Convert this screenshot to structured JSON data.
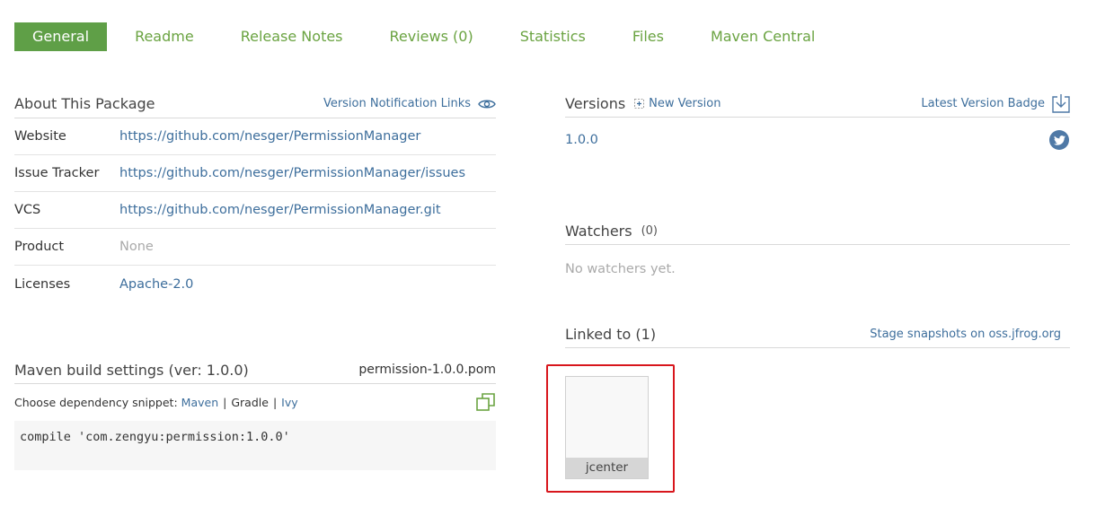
{
  "tabs": [
    {
      "label": "General",
      "active": true
    },
    {
      "label": "Readme"
    },
    {
      "label": "Release Notes"
    },
    {
      "label": "Reviews (0)"
    },
    {
      "label": "Statistics"
    },
    {
      "label": "Files"
    },
    {
      "label": "Maven Central"
    }
  ],
  "about": {
    "title": "About This Package",
    "notification_link": "Version Notification Links",
    "rows": [
      {
        "label": "Website",
        "value": "https://github.com/nesger/PermissionManager"
      },
      {
        "label": "Issue Tracker",
        "value": "https://github.com/nesger/PermissionManager/issues"
      },
      {
        "label": "VCS",
        "value": "https://github.com/nesger/PermissionManager.git"
      },
      {
        "label": "Product",
        "value": "None"
      },
      {
        "label": "Licenses",
        "value": "Apache-2.0"
      }
    ]
  },
  "maven": {
    "title": "Maven build settings (ver: 1.0.0)",
    "pom_file": "permission-1.0.0.pom",
    "choose_label": "Choose dependency snippet:",
    "options": [
      "Maven",
      "Gradle",
      "Ivy"
    ],
    "selected": "Gradle",
    "snippet": "compile 'com.zengyu:permission:1.0.0'"
  },
  "versions": {
    "title": "Versions",
    "new_version": "New Version",
    "badge": "Latest Version Badge",
    "items": [
      "1.0.0"
    ]
  },
  "watchers": {
    "title": "Watchers",
    "count": "(0)",
    "empty": "No watchers yet."
  },
  "linked": {
    "title": "Linked to (1)",
    "stage_link": "Stage snapshots on oss.jfrog.org",
    "repos": [
      "jcenter"
    ]
  },
  "colors": {
    "accent_green": "#5f9f47",
    "link_blue": "#3d6e9c",
    "highlight_red": "#d8161c"
  },
  "icons": {
    "notification": "eye-icon",
    "new_version": "plus-icon",
    "badge": "download-icon",
    "share": "twitter-icon",
    "copy": "copy-icon"
  }
}
